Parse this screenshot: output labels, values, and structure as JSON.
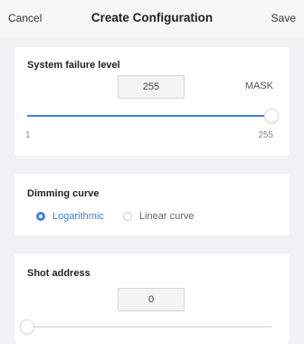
{
  "header": {
    "cancel_label": "Cancel",
    "title": "Create Configuration",
    "save_label": "Save"
  },
  "system_failure": {
    "label": "System failure level",
    "value": "255",
    "unit": "MASK",
    "min_label": "1",
    "max_label": "255",
    "slider_fraction": 1.0
  },
  "dimming": {
    "label": "Dimming curve",
    "options": [
      {
        "label": "Logarithmic",
        "selected": true
      },
      {
        "label": "Linear curve",
        "selected": false
      }
    ]
  },
  "shot_address": {
    "label": "Shot address",
    "value": "0",
    "slider_fraction": 0.0
  },
  "colors": {
    "accent": "#3f7fe0",
    "track_inactive": "#e3e3e3",
    "background": "#f2f2f4"
  }
}
